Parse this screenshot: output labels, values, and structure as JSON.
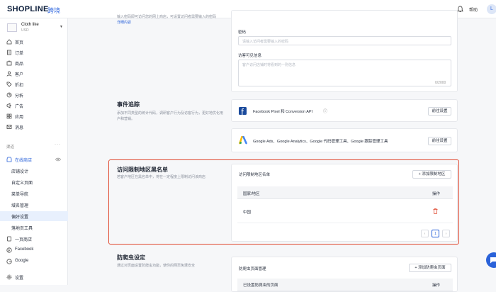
{
  "topbar": {
    "logo": "SHOPLINE",
    "logo_sub": "跨境",
    "help": "帮助",
    "avatar": "L"
  },
  "sidebar": {
    "store_name": "Cloth like",
    "store_currency": "USD",
    "items": [
      {
        "label": "首页",
        "icon": "home-icon"
      },
      {
        "label": "订单",
        "icon": "order-icon"
      },
      {
        "label": "商品",
        "icon": "product-icon"
      },
      {
        "label": "客户",
        "icon": "customer-icon"
      },
      {
        "label": "折扣",
        "icon": "discount-icon"
      },
      {
        "label": "分析",
        "icon": "analytics-icon"
      },
      {
        "label": "广告",
        "icon": "ads-icon"
      },
      {
        "label": "应用",
        "icon": "apps-icon"
      },
      {
        "label": "消息",
        "icon": "message-icon"
      }
    ],
    "channels_label": "渠道",
    "channels_dots": "···",
    "online_store": "在线商店",
    "sub_items": [
      {
        "label": "店铺设计"
      },
      {
        "label": "自定义页面"
      },
      {
        "label": "菜单导航"
      },
      {
        "label": "域名管理"
      },
      {
        "label": "偏好设置"
      },
      {
        "label": "落地页工具"
      }
    ],
    "channel_items": [
      {
        "label": "一页商店",
        "icon": "one-page-icon"
      },
      {
        "label": "Facebook",
        "icon": "facebook-icon"
      },
      {
        "label": "Google",
        "icon": "google-icon"
      }
    ],
    "settings": "设置"
  },
  "top_section": {
    "desc_line1": "输入密码即可访问您的网上商店，可设置访问者需要输入的密码",
    "link": "详细内容",
    "password_label": "密码",
    "password_placeholder": "请输入访问者需要输入的密码",
    "message_label": "访客可见信息",
    "message_placeholder": "客户访问店铺时将看到的一则信息",
    "counter": "0/2000"
  },
  "event_tracking": {
    "title": "事件追踪",
    "desc": "添加不同类型的统计代码，调研客户行为及访客行为，更好地优化用户和营销。",
    "facebook_label": "Facebook Pixel 和 Conversion API",
    "facebook_btn": "前往设置",
    "google_label": "Google Ads、Google Analytics、Google 代码管理工具、Google 跟踪管理工具",
    "google_btn": "前往设置"
  },
  "region_blacklist": {
    "title": "访问限制地区黑名单",
    "desc": "若客户地区在黑名单中，将在一定程度上限制访问该商店",
    "card_title": "访问限制地区名单",
    "add_btn": "+ 添加限制地区",
    "col_region": "国家/地区",
    "col_action": "操作",
    "rows": [
      {
        "region": "中国"
      }
    ],
    "page_prev": "‹",
    "page_current": "1",
    "page_next": "›"
  },
  "anti_crawler": {
    "title": "防爬虫设定",
    "desc": "通过对页面设置防爬虫功能，使你的网页免遭安全",
    "card_title": "防爬虫页面管理",
    "add_btn": "+ 添加防爬虫页面",
    "col_page": "已设置防爬虫的页面",
    "col_action": "操作"
  },
  "colors": {
    "accent": "#2a62d9",
    "highlight_border": "#e0482f",
    "delete": "#e0482f"
  }
}
